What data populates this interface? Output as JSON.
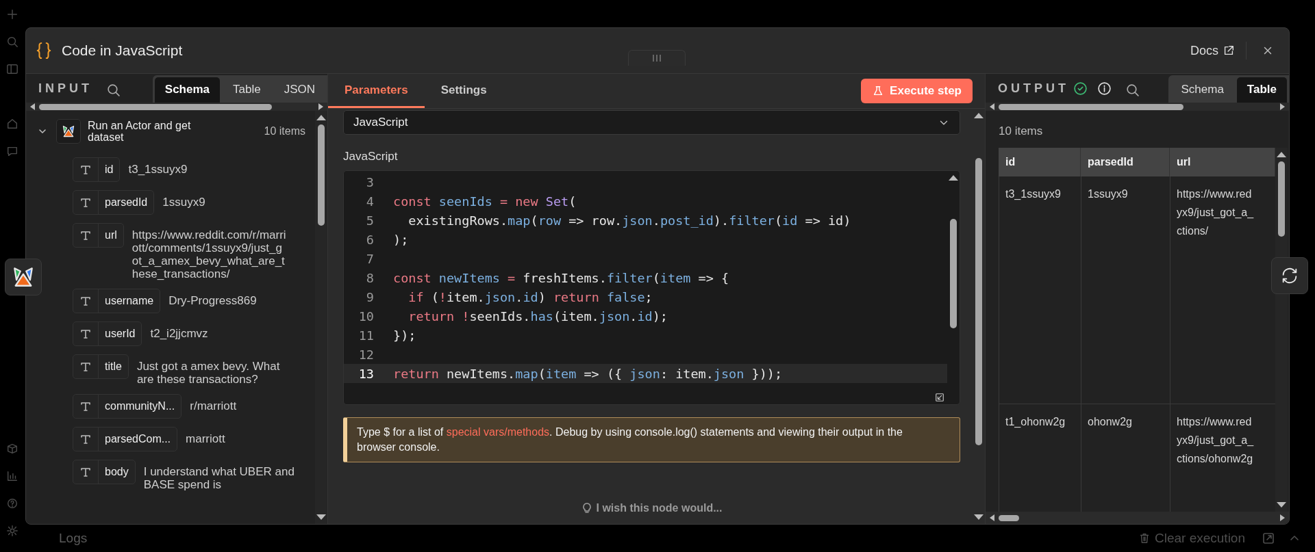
{
  "background": {
    "logs_label": "Logs",
    "clear_button": "Clear execution"
  },
  "window": {
    "title": "Code in JavaScript",
    "docs_link": "Docs"
  },
  "input_panel": {
    "title": "INPUT",
    "tabs": [
      {
        "label": "Schema",
        "selected": true
      },
      {
        "label": "Table",
        "selected": false
      },
      {
        "label": "JSON",
        "selected": false
      }
    ],
    "node": {
      "name": "Run an Actor and get dataset",
      "count": "10 items",
      "expanded": true,
      "fields": [
        {
          "key": "id",
          "value": "t3_1ssuyx9"
        },
        {
          "key": "parsedId",
          "value": "1ssuyx9"
        },
        {
          "key": "url",
          "value": "https://www.reddit.com/r/marriott/comments/1ssuyx9/just_got_a_amex_bevy_what_are_these_transactions/"
        },
        {
          "key": "username",
          "value": "Dry-Progress869"
        },
        {
          "key": "userId",
          "value": "t2_i2jjcmvz"
        },
        {
          "key": "title",
          "value": "Just got a amex bevy. What are these transactions?"
        },
        {
          "key": "communityN...",
          "value": "r/marriott"
        },
        {
          "key": "parsedCom...",
          "value": "marriott"
        },
        {
          "key": "body",
          "value": "I understand what UBER and BASE spend is"
        }
      ]
    }
  },
  "parameters_panel": {
    "tabs": [
      {
        "label": "Parameters",
        "selected": true
      },
      {
        "label": "Settings",
        "selected": false
      }
    ],
    "execute_button": "Execute step",
    "language_select": {
      "value": "JavaScript"
    },
    "code_label": "JavaScript",
    "code_lines": [
      {
        "number": "3",
        "active": false
      },
      {
        "number": "4",
        "active": false,
        "tokens": [
          {
            "text": "const",
            "kind": "keyword"
          },
          {
            "text": " seenIds",
            "kind": "name"
          },
          {
            "text": " =",
            "kind": "operator"
          },
          {
            "text": " new",
            "kind": "keyword"
          },
          {
            "text": " Set",
            "kind": "type"
          },
          {
            "text": "(",
            "kind": "plain"
          }
        ]
      },
      {
        "number": "5",
        "active": false,
        "tokens": [
          {
            "text": "  existingRows.",
            "kind": "plain"
          },
          {
            "text": "map",
            "kind": "name"
          },
          {
            "text": "(",
            "kind": "plain"
          },
          {
            "text": "row",
            "kind": "name"
          },
          {
            "text": " => row.",
            "kind": "plain"
          },
          {
            "text": "json",
            "kind": "name"
          },
          {
            "text": ".",
            "kind": "plain"
          },
          {
            "text": "post_id",
            "kind": "name"
          },
          {
            "text": ").",
            "kind": "plain"
          },
          {
            "text": "filter",
            "kind": "name"
          },
          {
            "text": "(",
            "kind": "plain"
          },
          {
            "text": "id",
            "kind": "name"
          },
          {
            "text": " => id)",
            "kind": "plain"
          }
        ]
      },
      {
        "number": "6",
        "active": false,
        "tokens": [
          {
            "text": ");",
            "kind": "plain"
          }
        ]
      },
      {
        "number": "7",
        "active": false
      },
      {
        "number": "8",
        "active": false,
        "tokens": [
          {
            "text": "const",
            "kind": "keyword"
          },
          {
            "text": " newItems",
            "kind": "name"
          },
          {
            "text": " =",
            "kind": "operator"
          },
          {
            "text": " freshItems.",
            "kind": "plain"
          },
          {
            "text": "filter",
            "kind": "name"
          },
          {
            "text": "(",
            "kind": "plain"
          },
          {
            "text": "item",
            "kind": "name"
          },
          {
            "text": " => {",
            "kind": "plain"
          }
        ]
      },
      {
        "number": "9",
        "active": false,
        "tokens": [
          {
            "text": "  if",
            "kind": "keyword"
          },
          {
            "text": " (",
            "kind": "plain"
          },
          {
            "text": "!",
            "kind": "operator"
          },
          {
            "text": "item.",
            "kind": "plain"
          },
          {
            "text": "json",
            "kind": "name"
          },
          {
            "text": ".",
            "kind": "plain"
          },
          {
            "text": "id",
            "kind": "name"
          },
          {
            "text": ") ",
            "kind": "plain"
          },
          {
            "text": "return",
            "kind": "keyword"
          },
          {
            "text": " false",
            "kind": "name"
          },
          {
            "text": ";",
            "kind": "plain"
          }
        ]
      },
      {
        "number": "10",
        "active": false,
        "tokens": [
          {
            "text": "  return",
            "kind": "keyword"
          },
          {
            "text": " !",
            "kind": "operator"
          },
          {
            "text": "seenIds.",
            "kind": "plain"
          },
          {
            "text": "has",
            "kind": "name"
          },
          {
            "text": "(item.",
            "kind": "plain"
          },
          {
            "text": "json",
            "kind": "name"
          },
          {
            "text": ".",
            "kind": "plain"
          },
          {
            "text": "id",
            "kind": "name"
          },
          {
            "text": ");",
            "kind": "plain"
          }
        ]
      },
      {
        "number": "11",
        "active": false,
        "tokens": [
          {
            "text": "});",
            "kind": "plain"
          }
        ]
      },
      {
        "number": "12",
        "active": false
      },
      {
        "number": "13",
        "active": true,
        "tokens": [
          {
            "text": "return",
            "kind": "keyword"
          },
          {
            "text": " newItems.",
            "kind": "plain"
          },
          {
            "text": "map",
            "kind": "name"
          },
          {
            "text": "(",
            "kind": "plain"
          },
          {
            "text": "item",
            "kind": "name"
          },
          {
            "text": " => ({ ",
            "kind": "plain"
          },
          {
            "text": "json",
            "kind": "name"
          },
          {
            "text": ": item.",
            "kind": "plain"
          },
          {
            "text": "json",
            "kind": "name"
          },
          {
            "text": " }));",
            "kind": "plain"
          }
        ]
      }
    ],
    "notice": {
      "before": "Type $ for a list of ",
      "link": "special vars/methods",
      "after": ". Debug by using console.log() statements and viewing their output in the browser console."
    },
    "feedback_link": "I wish this node would..."
  },
  "output_panel": {
    "title": "OUTPUT",
    "count": "10 items",
    "tabs": [
      {
        "label": "Schema",
        "selected": false
      },
      {
        "label": "Table",
        "selected": true
      }
    ],
    "table": {
      "columns": [
        "id",
        "parsedId",
        "url"
      ],
      "rows": [
        {
          "cells": [
            [
              "t3_1ssuyx9"
            ],
            [
              "1ssuyx9"
            ],
            [
              "https://www.red",
              "yx9/just_got_a_",
              "ctions/"
            ]
          ]
        },
        {
          "cells": [
            [
              "t1_ohonw2g"
            ],
            [
              "ohonw2g"
            ],
            [
              "https://www.red",
              "yx9/just_got_a_",
              "ctions/ohonw2g"
            ]
          ]
        }
      ]
    }
  }
}
